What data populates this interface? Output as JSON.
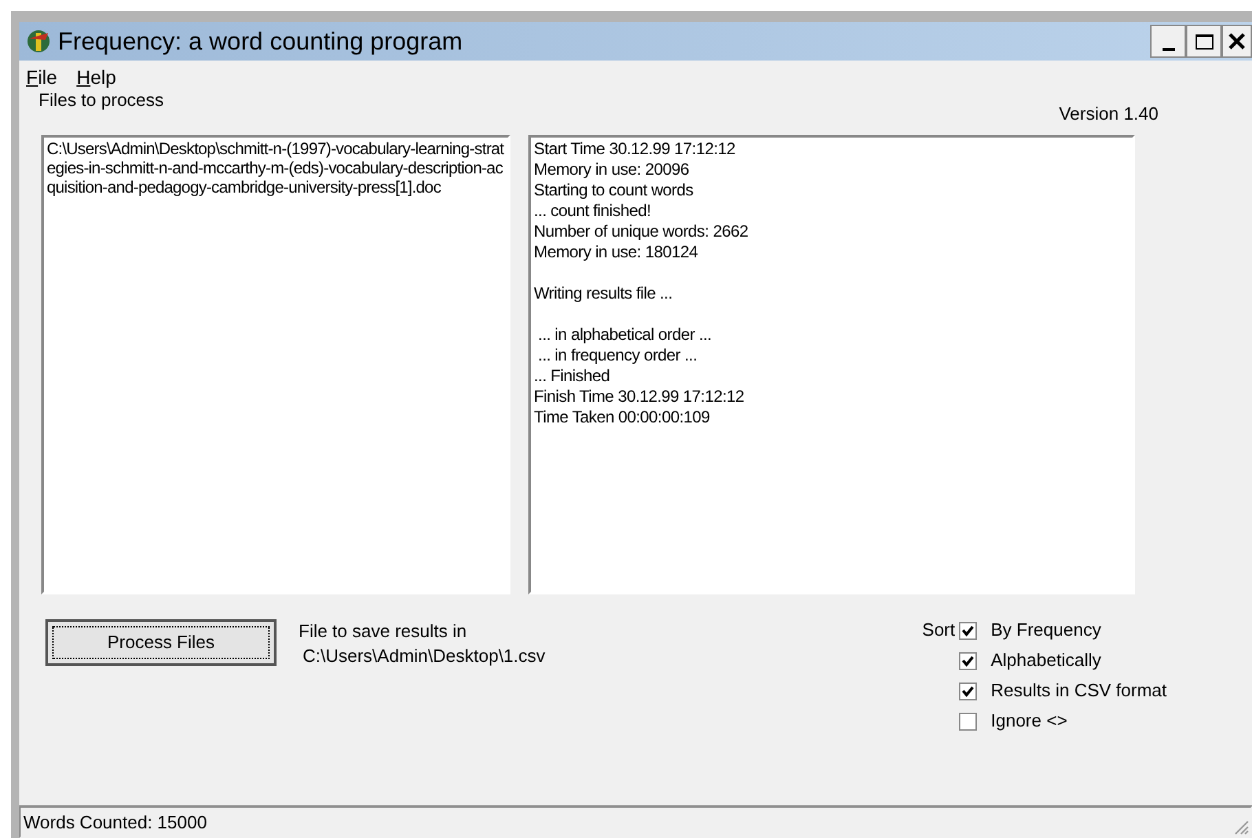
{
  "window": {
    "title": "Frequency: a word counting program"
  },
  "menu": [
    {
      "label": "File"
    },
    {
      "label": "Help"
    }
  ],
  "files_label": "Files to process",
  "version": "Version 1.40",
  "files": [
    "C:\\Users\\Admin\\Desktop\\schmitt-n-(1997)-vocabulary-learning-strategies-in-schmitt-n-and-mccarthy-m-(eds)-vocabulary-description-acquisition-and-pedagogy-cambridge-university-press[1].doc"
  ],
  "log": [
    {
      "text": "Start Time 30.12.99 17:12:12",
      "gap_before": false
    },
    {
      "text": "Memory in use: 20096",
      "gap_before": false
    },
    {
      "text": "Starting to count words",
      "gap_before": false
    },
    {
      "text": "... count finished!",
      "gap_before": false
    },
    {
      "text": "Number of unique words: 2662",
      "gap_before": false
    },
    {
      "text": "Memory in use: 180124",
      "gap_before": false
    },
    {
      "text": "Writing results file ...",
      "gap_before": true
    },
    {
      "text": " ... in alphabetical order ...",
      "gap_before": true
    },
    {
      "text": " ... in frequency order ...",
      "gap_before": false
    },
    {
      "text": "... Finished",
      "gap_before": false
    },
    {
      "text": "Finish Time 30.12.99 17:12:12",
      "gap_before": false
    },
    {
      "text": "Time Taken 00:00:00:109",
      "gap_before": false
    }
  ],
  "process_button": "Process Files",
  "save_label": "File to save results in",
  "save_path": "C:\\Users\\Admin\\Desktop\\1.csv",
  "sort_label": "Sort",
  "options": [
    {
      "label": "By Frequency",
      "checked": true
    },
    {
      "label": "Alphabetically",
      "checked": true
    },
    {
      "label": "Results in CSV format",
      "checked": true
    },
    {
      "label": "Ignore <>",
      "checked": false
    }
  ],
  "status_bar": "Words Counted: 15000"
}
